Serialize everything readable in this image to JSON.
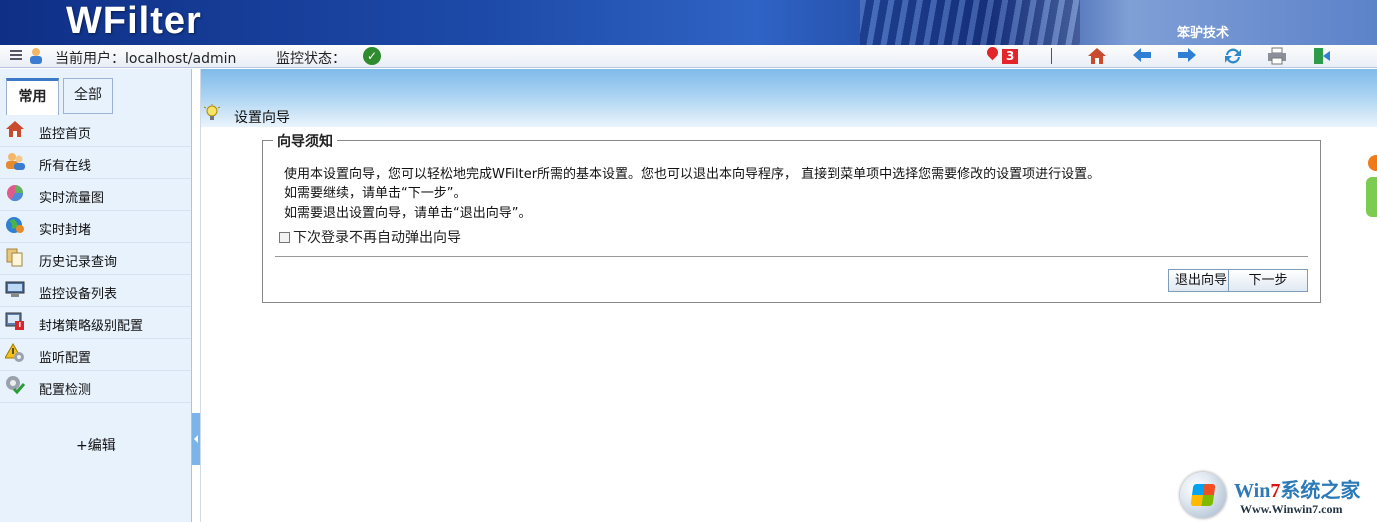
{
  "header": {
    "logo": "WFilter",
    "brand": "笨驴技术"
  },
  "statusbar": {
    "user_label": "当前用户：localhost/admin",
    "monitor_label": "监控状态：",
    "monitor_status_icon": "check-circle-icon",
    "alert_count": "3",
    "toolbar_icons": [
      "home-icon",
      "back-arrow-icon",
      "forward-arrow-icon",
      "refresh-icon",
      "print-icon",
      "logout-icon"
    ]
  },
  "sidebar": {
    "tabs": [
      {
        "label": "常用",
        "active": true
      },
      {
        "label": "全部",
        "active": false
      }
    ],
    "items": [
      {
        "label": "监控首页",
        "icon": "home-icon"
      },
      {
        "label": "所有在线",
        "icon": "users-icon"
      },
      {
        "label": "实时流量图",
        "icon": "pie-chart-icon"
      },
      {
        "label": "实时封堵",
        "icon": "globe-block-icon"
      },
      {
        "label": "历史记录查询",
        "icon": "documents-icon"
      },
      {
        "label": "监控设备列表",
        "icon": "monitor-icon"
      },
      {
        "label": "封堵策略级别配置",
        "icon": "policy-warning-icon"
      },
      {
        "label": "监听配置",
        "icon": "gear-warning-icon"
      },
      {
        "label": "配置检测",
        "icon": "gear-check-icon"
      }
    ],
    "edit_label": "+编辑"
  },
  "main": {
    "title": "设置向导",
    "panel": {
      "legend": "向导须知",
      "lines": [
        "使用本设置向导，您可以轻松地完成WFilter所需的基本设置。您也可以退出本向导程序， 直接到菜单项中选择您需要修改的设置项进行设置。",
        "如需要继续，请单击“下一步”。",
        "如需要退出设置向导，请单击“退出向导”。"
      ],
      "checkbox_label": "下次登录不再自动弹出向导",
      "exit_button": "退出向导",
      "next_button": "下一步"
    }
  },
  "watermark": {
    "brand_part1": "Win",
    "brand_part2": "7",
    "brand_part3": "系统之家",
    "url": "Www.Winwin7.com"
  }
}
